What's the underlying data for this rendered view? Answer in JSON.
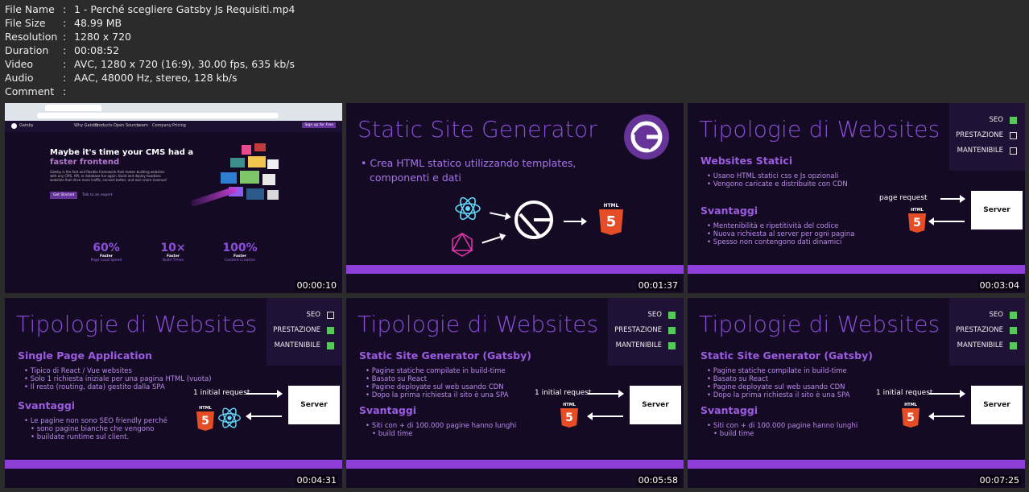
{
  "info": [
    {
      "key": "File Name",
      "value": "1 - Perché scegliere Gatsby Js Requisiti.mp4"
    },
    {
      "key": "File Size",
      "value": "48.99 MB"
    },
    {
      "key": "Resolution",
      "value": "1280 x 720"
    },
    {
      "key": "Duration",
      "value": "00:08:52"
    },
    {
      "key": "Video",
      "value": "AVC, 1280 x 720 (16:9), 30.00 fps, 635 kb/s"
    },
    {
      "key": "Audio",
      "value": "AAC, 48000 Hz, stereo, 128 kb/s"
    },
    {
      "key": "Comment",
      "value": ""
    }
  ],
  "thumbs": {
    "t1": {
      "timestamp": "00:00:10",
      "nav": [
        "Gatsby",
        "Why Gatsby",
        "Products",
        "Open Source",
        "Learn",
        "Company",
        "Pricing"
      ],
      "cta": "Sign up for Free",
      "headline": "Maybe it's time your CMS had a",
      "headline_accent": "faster frontend",
      "body": "Gatsby is the fast and flexible framework that makes building websites with any CMS, API, or database fun again. Build and deploy headless websites that drive more traffic, convert better, and earn more revenue!",
      "btn": "Get Started",
      "link": "Talk to an expert",
      "stats": [
        {
          "big": "60%",
          "l1": "Faster",
          "l2": "Page Load Speed"
        },
        {
          "big": "10×",
          "l1": "Faster",
          "l2": "Build Times"
        },
        {
          "big": "100%",
          "l1": "Faster",
          "l2": "Content Creation"
        }
      ]
    },
    "t2": {
      "timestamp": "00:01:37",
      "title": "Static Site Generator",
      "bullet1": "Crea HTML statico utilizzando templates,",
      "bullet2": "componenti e dati",
      "html_label": "HTML"
    },
    "t3": {
      "timestamp": "00:03:04",
      "title": "Tipologie di Websites",
      "checks": [
        {
          "label": "SEO",
          "on": true
        },
        {
          "label": "PRESTAZIONE",
          "on": false
        },
        {
          "label": "MANTENIBILE",
          "on": false
        }
      ],
      "sub1": "Websites Statici",
      "b1": [
        "Usano HTML statici css e Js opzionali",
        "Vengono caricate e distribuite con CDN"
      ],
      "sub2": "Svantaggi",
      "b2": [
        "Mentenibilità e ripetitività del codice",
        "Nuova richiesta al server per ogni pagina",
        "Spesso non contengono dati dinamici"
      ],
      "req": "page request",
      "server": "Server",
      "html_label": "HTML"
    },
    "t4": {
      "timestamp": "00:04:31",
      "title": "Tipologie di Websites",
      "checks": [
        {
          "label": "SEO",
          "on": false
        },
        {
          "label": "PRESTAZIONE",
          "on": true
        },
        {
          "label": "MANTENIBILE",
          "on": true
        }
      ],
      "sub1": "Single Page Application",
      "b1": [
        "Tipico di React / Vue websites",
        "Solo 1 richiesta iniziale per una pagina HTML (vuota)",
        "Il resto (routing, data) gestito dalla SPA"
      ],
      "sub2": "Svantaggi",
      "b2": [
        "Le pagine non sono SEO friendly perché",
        "sono pagine bianche che vengono",
        "buildate runtime sul client."
      ],
      "req": "1 initial request",
      "server": "Server",
      "html_label": "HTML"
    },
    "t5": {
      "timestamp": "00:05:58",
      "title": "Tipologie di Websites",
      "checks": [
        {
          "label": "SEO",
          "on": true
        },
        {
          "label": "PRESTAZIONE",
          "on": true
        },
        {
          "label": "MANTENIBILE",
          "on": true
        }
      ],
      "sub1": "Static Site Generator (Gatsby)",
      "b1": [
        "Pagine statiche compilate in build-time",
        "Basato su React",
        "Pagine deployate sul web usando CDN",
        "Dopo la prima richiesta il sito è una SPA"
      ],
      "sub2": "Svantaggi",
      "b2": [
        "Siti con + di 100.000 pagine hanno lunghi",
        "build time"
      ],
      "req": "1 initial request",
      "server": "Server",
      "html_label": "HTML"
    },
    "t6": {
      "timestamp": "00:07:25",
      "title": "Tipologie di Websites",
      "checks": [
        {
          "label": "SEO",
          "on": true
        },
        {
          "label": "PRESTAZIONE",
          "on": true
        },
        {
          "label": "MANTENIBILE",
          "on": true
        }
      ],
      "sub1": "Static Site Generator (Gatsby)",
      "b1": [
        "Pagine statiche compilate in build-time",
        "Basato su React",
        "Pagine deployate sul web usando CDN",
        "Dopo la prima richiesta il sito è una SPA"
      ],
      "sub2": "Svantaggi",
      "b2": [
        "Siti con + di 100.000 pagine hanno lunghi",
        "build time"
      ],
      "req": "1 initial request",
      "server": "Server",
      "html_label": "HTML"
    }
  }
}
